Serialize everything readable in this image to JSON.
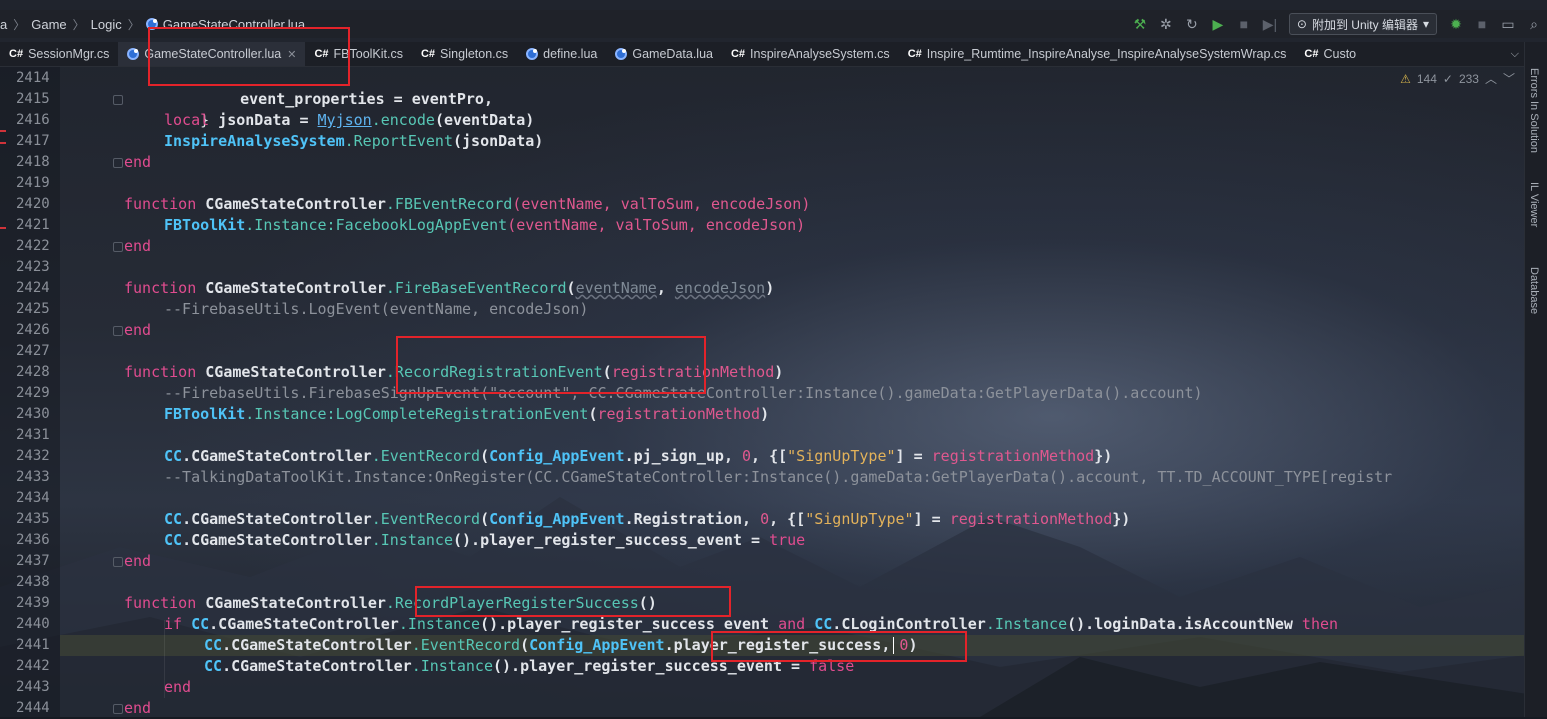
{
  "breadcrumb": {
    "items": [
      "a",
      "Game",
      "Logic",
      "GameStateController.lua"
    ]
  },
  "toolbar": {
    "attach_label": "附加到 Unity 编辑器",
    "icons": [
      "hammer-icon",
      "debug-icon",
      "refresh-icon",
      "run-icon",
      "stop-icon",
      "step-icon"
    ]
  },
  "tabs": [
    {
      "label": "SessionMgr.cs",
      "type": "cs"
    },
    {
      "label": "GameStateController.lua",
      "type": "lua",
      "active": true
    },
    {
      "label": "FBToolKit.cs",
      "type": "cs"
    },
    {
      "label": "Singleton.cs",
      "type": "cs"
    },
    {
      "label": "define.lua",
      "type": "lua"
    },
    {
      "label": "GameData.lua",
      "type": "lua"
    },
    {
      "label": "InspireAnalyseSystem.cs",
      "type": "cs"
    },
    {
      "label": "Inspire_Rumtime_InspireAnalyse_InspireAnalyseSystemWrap.cs",
      "type": "cs"
    },
    {
      "label": "Custo",
      "type": "cs"
    }
  ],
  "cs_prefix": "C#",
  "inspections": {
    "warnings": "144",
    "weak": "233"
  },
  "side_panels": [
    "Errors In Solution",
    "IL Viewer",
    "Database"
  ],
  "line_numbers": [
    "2414",
    "2415",
    "2416",
    "2417",
    "2418",
    "2419",
    "2420",
    "2421",
    "2422",
    "2423",
    "2424",
    "2425",
    "2426",
    "2427",
    "2428",
    "2429",
    "2430",
    "2431",
    "2432",
    "2433",
    "2434",
    "2435",
    "2436",
    "2437",
    "2438",
    "2439",
    "2440",
    "2441",
    "2442",
    "2443",
    "2444"
  ],
  "code": {
    "l2414": "event_properties = eventPro,",
    "l2415": "}",
    "l2416_kw": "local",
    "l2416_a": " jsonData = ",
    "l2416_b": "Myjson",
    "l2416_c": ".encode",
    "l2416_d": "(eventData)",
    "l2417_a": "InspireAnalyseSystem",
    "l2417_b": ".ReportEvent",
    "l2417_c": "(jsonData)",
    "end": "end",
    "function": "function",
    "ctrl": "CGameStateController",
    "l2420_m": ".FBEventRecord",
    "l2420_p": "(eventName, valToSum, encodeJson)",
    "l2421_a": "FBToolKit",
    "l2421_b": ".Instance:",
    "l2421_c": "FacebookLogAppEvent",
    "l2421_d": "(eventName, valToSum, encodeJson)",
    "l2424_m": ".FireBaseEventRecord",
    "l2424_p1": "eventName",
    "l2424_p2": "encodeJson",
    "l2425": "--FirebaseUtils.LogEvent(eventName, encodeJson)",
    "l2428_m": ".RecordRegistrationEvent",
    "l2428_p": "registrationMethod",
    "l2429": "--FirebaseUtils.FirebaseSignUpEvent(\"account\", CC.CGameStateController:Instance().gameData:GetPlayerData().account)",
    "l2430_c": "LogCompleteRegistrationEvent",
    "cc": "CC",
    "dot_ctrl": ".CGameStateController",
    "event_record": ".EventRecord",
    "config": "Config_AppEvent",
    "l2432_f": ".pj_sign_up",
    "zero": "0",
    "signup_key": "\"SignUpType\"",
    "l2433": "--TalkingDataToolKit.Instance:OnRegister(CC.CGameStateController:Instance().gameData:GetPlayerData().account, TT.TD_ACCOUNT_TYPE[registr",
    "l2435_f": ".Registration",
    "instance": ".Instance",
    "l2436_f": "().player_register_success_event = ",
    "true": "true",
    "false": "false",
    "l2439_m": ".RecordPlayerRegisterSuccess",
    "if": "if",
    "l2440_a": "().player_register_success_event ",
    "and": "and",
    "login": ".CLoginController",
    "l2440_b": "().loginData.isAccountNew ",
    "then": "then",
    "l2441_f": ".player_register_success",
    "l2442_f": "().player_register_success_event = "
  },
  "colors": {
    "highlight_box": "#e3232a",
    "keyword": "#e04c8f",
    "class": "#4fc3f7",
    "method": "#57c7b5",
    "string": "#e3b25a"
  }
}
